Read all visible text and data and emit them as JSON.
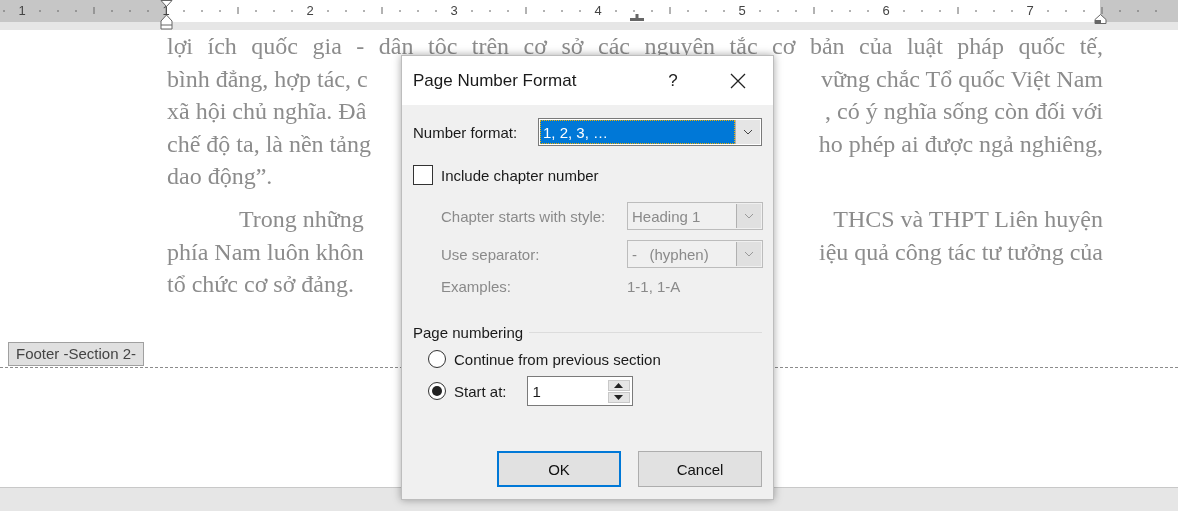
{
  "ruler": {
    "labels": [
      "1",
      "1",
      "2",
      "3",
      "4",
      "5",
      "6",
      "7"
    ]
  },
  "document": {
    "paragraphs": [
      {
        "first_line_indent": false,
        "lines": [
          {
            "kind": "full",
            "left": "lợi ích quốc gia - dân tộc trên cơ sở các nguyên tắc cơ bản của luật pháp quốc tế,"
          },
          {
            "kind": "split",
            "left": "bình đẳng, hợp tác, c",
            "right": "vững chắc Tổ quốc Việt Nam"
          },
          {
            "kind": "split",
            "left": "xã hội chủ nghĩa. Đâ",
            "right": ", có ý nghĩa sống còn đối với"
          },
          {
            "kind": "split",
            "left": "chế độ ta, là nền tảng",
            "right": "ho phép ai được ngả nghiêng,"
          },
          {
            "kind": "end",
            "left": "dao động”."
          }
        ]
      },
      {
        "first_line_indent": true,
        "lines": [
          {
            "kind": "split",
            "left": "Trong những",
            "right": "THCS và THPT Liên huyện"
          },
          {
            "kind": "split",
            "left": "phía Nam luôn khôn",
            "right": "iệu quả công tác tư tưởng của"
          },
          {
            "kind": "end",
            "left": "tổ chức cơ sở đảng."
          }
        ]
      }
    ]
  },
  "footer_label": "Footer -Section 2-",
  "dialog": {
    "title": "Page Number Format",
    "help": "?",
    "number_format": {
      "label": "Number format:",
      "value": "1, 2, 3, …",
      "focused": true
    },
    "include_chapter": {
      "label": "Include chapter number",
      "checked": false
    },
    "chapter_style": {
      "label": "Chapter starts with style:",
      "value": "Heading 1",
      "disabled": true
    },
    "separator": {
      "label": "Use separator:",
      "value": "-   (hyphen)",
      "disabled": true
    },
    "examples": {
      "label": "Examples:",
      "value": "1-1, 1-A",
      "disabled": true
    },
    "page_numbering": {
      "heading": "Page numbering",
      "options": [
        {
          "label": "Continue from previous section",
          "selected": false
        },
        {
          "label": "Start at:",
          "selected": true
        }
      ],
      "start_at": "1"
    },
    "buttons": [
      {
        "label": "OK",
        "default": true
      },
      {
        "label": "Cancel",
        "default": false
      }
    ]
  }
}
